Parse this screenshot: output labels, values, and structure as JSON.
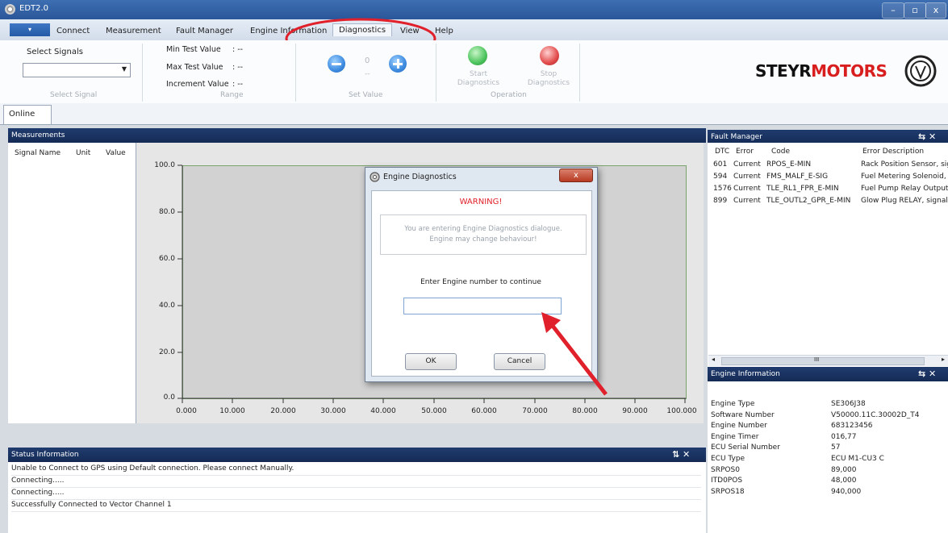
{
  "window": {
    "title": "EDT2.0",
    "minimize": "–",
    "maximize": "▫",
    "close": "x"
  },
  "menu": {
    "app_button": "▾",
    "items": [
      "Connect",
      "Measurement",
      "Fault Manager",
      "Engine Information",
      "Diagnostics",
      "View",
      "Help"
    ],
    "active": "Diagnostics"
  },
  "ribbon": {
    "select_signal": {
      "label": "Select Signals",
      "value": "",
      "group": "Select Signal"
    },
    "range": {
      "min_label": "Min Test Value",
      "min_value": ":  --",
      "max_label": "Max Test Value",
      "max_value": ":  --",
      "inc_label": "Increment Value",
      "inc_value": ":  --",
      "group": "Range"
    },
    "set_value": {
      "value": "0",
      "sub_value": "--",
      "group": "Set Value"
    },
    "operation": {
      "start": "Start\nDiagnostics",
      "stop": "Stop\nDiagnostics",
      "group": "Operation"
    },
    "colors": {
      "start_led": "#4cc45c",
      "stop_led": "#e24b4b",
      "minus": "#3d8be0",
      "plus": "#3d8be0"
    }
  },
  "logo": {
    "text_dark": "STEYR",
    "text_red": "MOTORS"
  },
  "tabs": {
    "online": "Online"
  },
  "measurements": {
    "title": "Measurements",
    "columns": [
      "Signal Name",
      "Unit",
      "Value"
    ],
    "chart": {
      "y_ticks": [
        "100.0",
        "80.0",
        "60.0",
        "40.0",
        "20.0",
        "0.0"
      ],
      "x_ticks": [
        "0.000",
        "10.000",
        "20.000",
        "30.000",
        "40.000",
        "50.000",
        "60.000",
        "70.000",
        "80.000",
        "90.000",
        "100.000"
      ]
    }
  },
  "status": {
    "title": "Status Information",
    "icons": "⇅ ✕",
    "lines": [
      "Unable to Connect to GPS using Default connection. Please connect Manually.",
      "Connecting.....",
      "Connecting.....",
      "Successfully Connected to Vector Channel 1"
    ]
  },
  "fault_manager": {
    "title": "Fault Manager",
    "icons": "⇆ ✕",
    "columns": [
      "DTC",
      "Error",
      "Code",
      "Error Description"
    ],
    "rows": [
      [
        "601",
        "Current",
        "RPOS_E-MIN",
        "Rack Position Sensor, sig"
      ],
      [
        "594",
        "Current",
        "FMS_MALF_E-SIG",
        "Fuel Metering Solenoid,"
      ],
      [
        "1576",
        "Current",
        "TLE_RL1_FPR_E-MIN",
        "Fuel Pump Relay Output"
      ],
      [
        "899",
        "Current",
        "TLE_OUTL2_GPR_E-MIN",
        "Glow Plug RELAY, signal"
      ]
    ],
    "scroll_thumb": "III"
  },
  "engine_info": {
    "title": "Engine Information",
    "icons": "⇆ ✕",
    "rows": [
      [
        "Engine Type",
        "SE306J38"
      ],
      [
        "Software Number",
        "V50000.11C.30002D_T4"
      ],
      [
        "Engine Number",
        "683123456"
      ],
      [
        "Engine Timer",
        "016,77"
      ],
      [
        "ECU Serial Number",
        "57"
      ],
      [
        "ECU Type",
        "ECU M1-CU3 C"
      ],
      [
        "SRPOS0",
        "89,000"
      ],
      [
        "ITD0POS",
        "48,000"
      ],
      [
        "SRPOS18",
        "940,000"
      ]
    ]
  },
  "dialog": {
    "title": "Engine Diagnostics",
    "close": "x",
    "warning": "WARNING!",
    "message_1": "You are entering Engine Diagnostics dialogue.",
    "message_2": "Engine may change behaviour!",
    "prompt": "Enter Engine number to continue",
    "input_value": "",
    "ok": "OK",
    "cancel": "Cancel"
  },
  "annotations": {
    "highlight_color": "#e0202a"
  }
}
